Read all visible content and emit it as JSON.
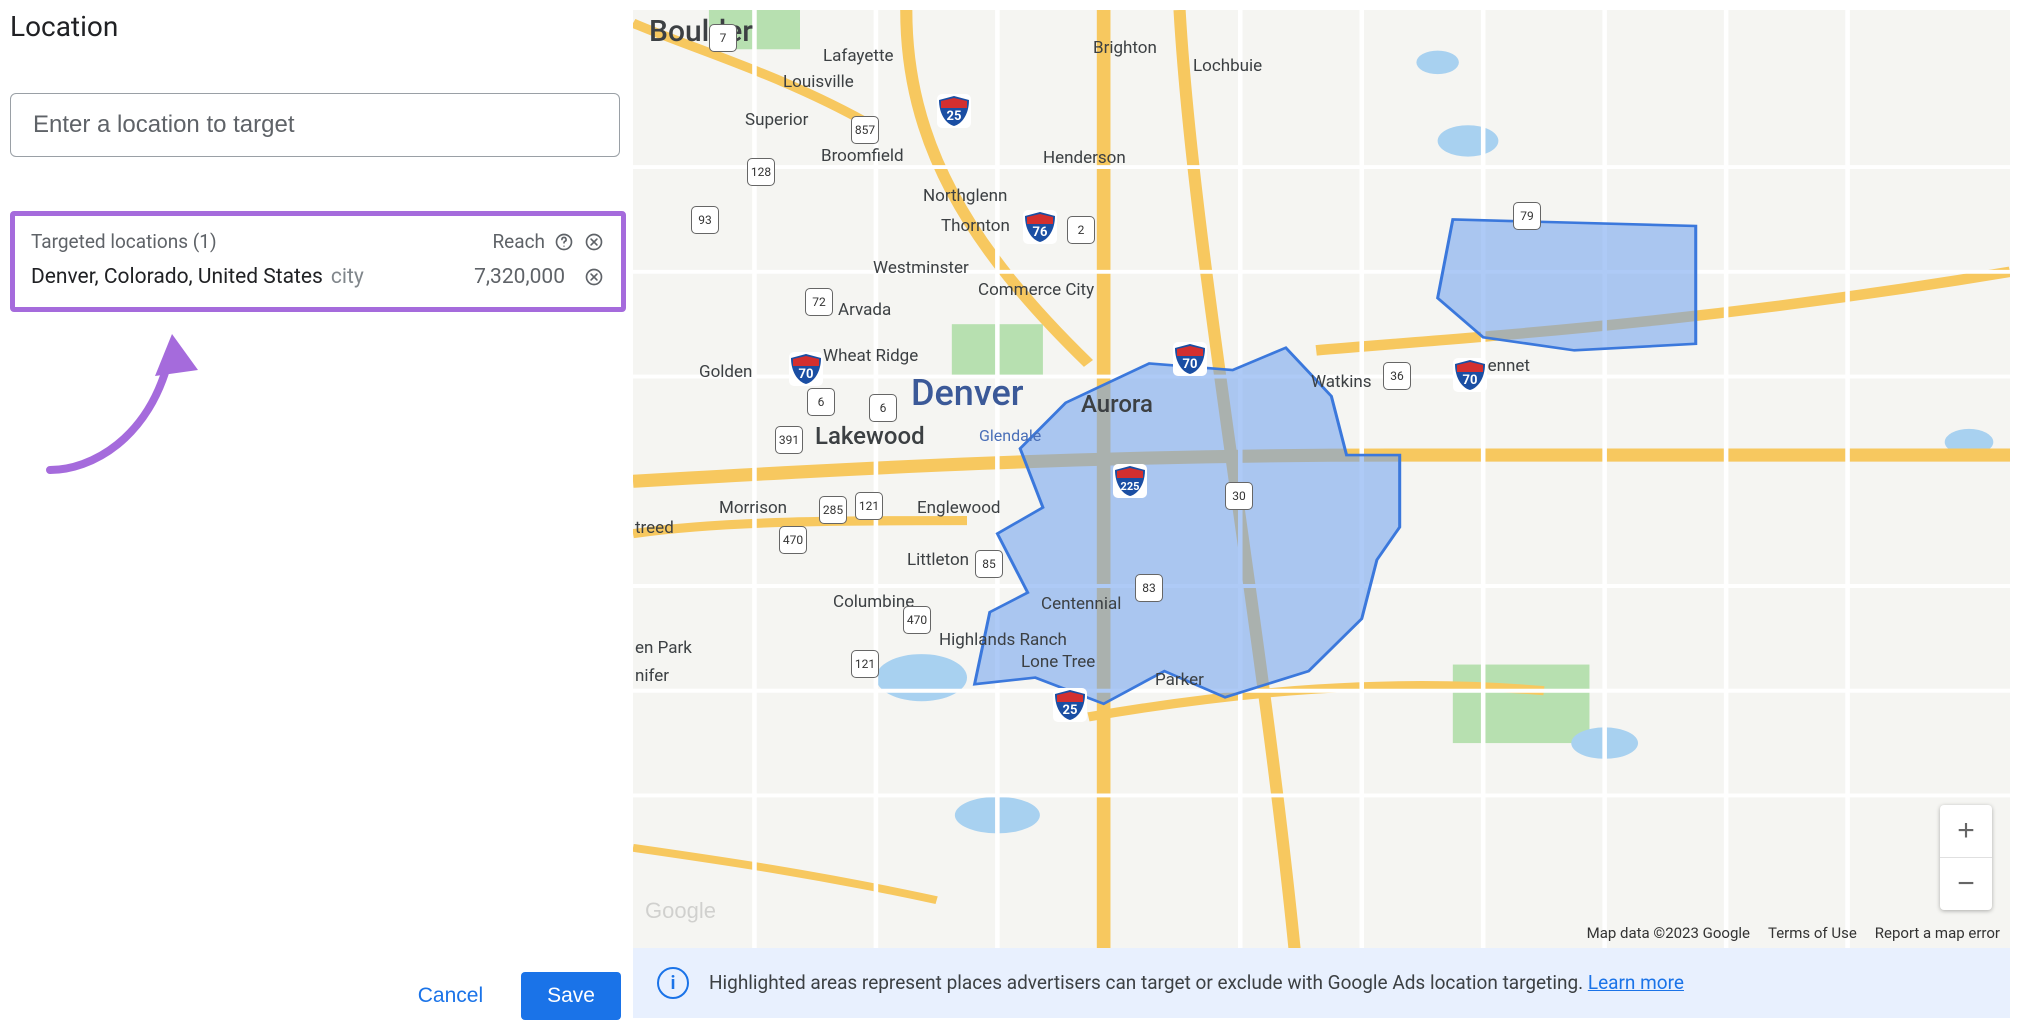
{
  "section": {
    "title": "Location"
  },
  "input": {
    "placeholder": "Enter a location to target"
  },
  "targeted": {
    "header_label": "Targeted locations (1)",
    "reach_label": "Reach",
    "row": {
      "name": "Denver, Colorado, United States",
      "type": "city",
      "reach": "7,320,000"
    }
  },
  "buttons": {
    "cancel": "Cancel",
    "save": "Save"
  },
  "map": {
    "logo": "Google",
    "attribution": "Map data ©2023 Google",
    "terms": "Terms of Use",
    "report": "Report a map error",
    "cities": {
      "boulder": "Boulder",
      "lafayette": "Lafayette",
      "louisville": "Louisville",
      "brighton": "Brighton",
      "superior": "Superior",
      "broomfield": "Broomfield",
      "henderson": "Henderson",
      "northglenn": "Northglenn",
      "thornton": "Thornton",
      "westminster": "Westminster",
      "arvada": "Arvada",
      "commerce": "Commerce City",
      "wheatridge": "Wheat Ridge",
      "golden": "Golden",
      "denver": "Denver",
      "aurora": "Aurora",
      "watkins": "Watkins",
      "bennet": "Bennet",
      "lakewood": "Lakewood",
      "glendale": "Glendale",
      "morrison": "Morrison",
      "englewood": "Englewood",
      "littleton": "Littleton",
      "columbine": "Columbine",
      "centennial": "Centennial",
      "park": "en Park",
      "nifer": "nifer",
      "highlands": "Highlands Ranch",
      "lonetree": "Lone Tree",
      "parker": "Parker",
      "lochbuie": "Lochbuie",
      "treed": "treed"
    },
    "shields": {
      "s7": "7",
      "s857": "857",
      "s128": "128",
      "s93": "93",
      "s2": "2",
      "s79": "79",
      "s72": "72",
      "s6a": "6",
      "s6b": "6",
      "s391": "391",
      "s121a": "121",
      "s285": "285",
      "s470a": "470",
      "s85a": "85",
      "s121b": "121",
      "s470b": "470",
      "s30": "30",
      "s225": "225",
      "s83": "83",
      "s36": "36",
      "i25a": "25",
      "i76": "76",
      "i70a": "70",
      "i70b": "70",
      "i70c": "70",
      "i25b": "25"
    }
  },
  "banner": {
    "text": "Highlighted areas represent places advertisers can target or exclude with Google Ads location targeting. ",
    "link": "Learn more"
  }
}
